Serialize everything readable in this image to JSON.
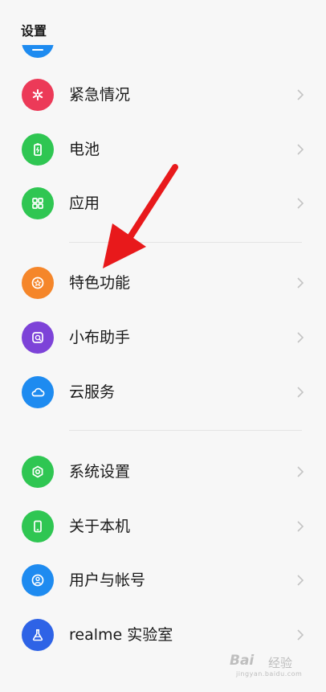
{
  "header": {
    "title": "设置"
  },
  "groups": [
    {
      "items": [
        {
          "label": "紧急情况",
          "icon": "emergency-asterisk-icon",
          "color": "#ec3a58"
        },
        {
          "label": "电池",
          "icon": "battery-icon",
          "color": "#2fc652"
        },
        {
          "label": "应用",
          "icon": "apps-grid-icon",
          "color": "#2fc652"
        }
      ]
    },
    {
      "items": [
        {
          "label": "特色功能",
          "icon": "star-badge-icon",
          "color": "#f5862a"
        },
        {
          "label": "小布助手",
          "icon": "assistant-icon",
          "color": "#7d43d8"
        },
        {
          "label": "云服务",
          "icon": "cloud-icon",
          "color": "#1e8bf0"
        }
      ]
    },
    {
      "items": [
        {
          "label": "系统设置",
          "icon": "hexagon-settings-icon",
          "color": "#2fc652"
        },
        {
          "label": "关于本机",
          "icon": "phone-icon",
          "color": "#2fc652"
        },
        {
          "label": "用户与帐号",
          "icon": "user-account-icon",
          "color": "#1e8bf0"
        },
        {
          "label": "realme 实验室",
          "icon": "lab-flask-icon",
          "color": "#2e63e6"
        }
      ]
    }
  ],
  "annotation": {
    "arrow_color": "#e8191b"
  },
  "watermark": {
    "main": "Bai",
    "sub": "经验",
    "url": "jingyan.baidu.com"
  }
}
